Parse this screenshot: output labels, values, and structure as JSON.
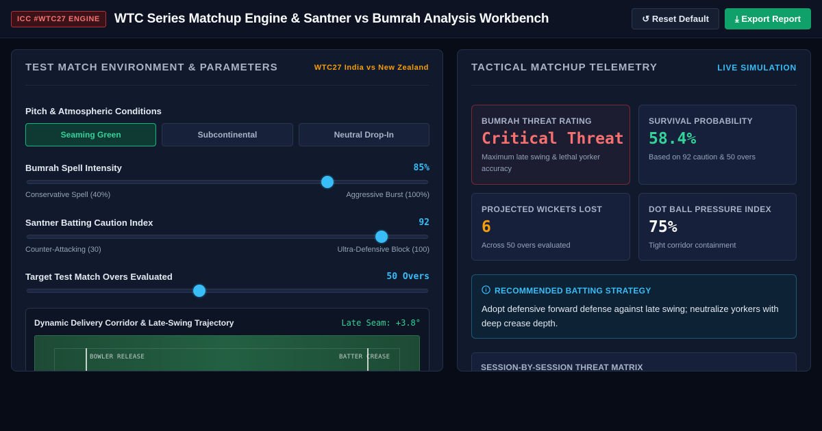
{
  "header": {
    "badge": "ICC #WTC27 ENGINE",
    "title": "WTC Series Matchup Engine & Santner vs Bumrah Analysis Workbench",
    "reset_label": "↺ Reset Default",
    "export_label": "⤓ Export Report"
  },
  "left_panel": {
    "title": "TEST MATCH ENVIRONMENT & PARAMETERS",
    "tag": "WTC27 India vs New Zealand",
    "pitch_section_label": "Pitch & Atmospheric Conditions",
    "pitch_options": [
      "Seaming Green",
      "Subcontinental",
      "Neutral Drop-In"
    ],
    "pitch_selected": "Seaming Green",
    "sliders": [
      {
        "name": "Bumrah Spell Intensity",
        "value": "85%",
        "min_label": "Conservative Spell (40%)",
        "max_label": "Aggressive Burst (100%)",
        "position": 0.75
      },
      {
        "name": "Santner Batting Caution Index",
        "value": "92",
        "min_label": "Counter-Attacking (30)",
        "max_label": "Ultra-Defensive Block (100)",
        "position": 0.886
      },
      {
        "name": "Target Test Match Overs Evaluated",
        "value": "50 Overs",
        "min_label": "",
        "max_label": "",
        "position": 0.43
      }
    ],
    "corridor": {
      "title": "Dynamic Delivery Corridor & Late-Swing Trajectory",
      "seam": "Late Seam: +3.8°",
      "bowler_label": "BOWLER RELEASE",
      "batter_label": "BATTER CREASE"
    }
  },
  "right_panel": {
    "title": "TACTICAL MATCHUP TELEMETRY",
    "tag": "LIVE SIMULATION",
    "cards": [
      {
        "label": "BUMRAH THREAT RATING",
        "value": "Critical Threat",
        "sub": "Maximum late swing & lethal yorker accuracy",
        "color": "#f87171"
      },
      {
        "label": "SURVIVAL PROBABILITY",
        "value": "58.4%",
        "sub": "Based on 92 caution & 50 overs",
        "color": "#34d399"
      },
      {
        "label": "PROJECTED WICKETS LOST",
        "value": "6",
        "sub": "Across 50 overs evaluated",
        "color": "#f59e0b"
      },
      {
        "label": "DOT BALL PRESSURE INDEX",
        "value": "75%",
        "sub": "Tight corridor containment",
        "color": "#f8fafc"
      }
    ],
    "strategy": {
      "title": "RECOMMENDED BATTING STRATEGY",
      "text": "Adopt defensive forward defense against late swing; neutralize yorkers with deep crease depth."
    },
    "matrix_title": "SESSION-BY-SESSION THREAT MATRIX"
  }
}
